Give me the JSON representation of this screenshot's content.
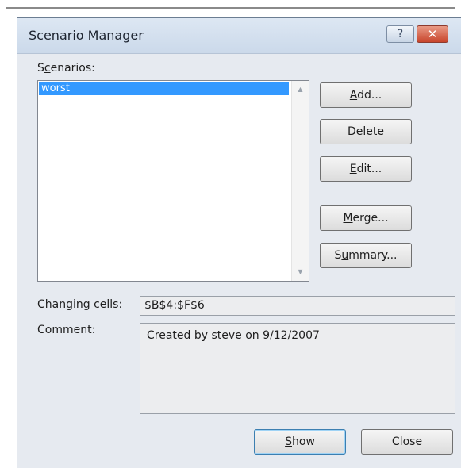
{
  "dialog": {
    "title": "Scenario Manager",
    "help_label": "?",
    "close_x_label": "✕"
  },
  "scenarios": {
    "label_pre": "S",
    "label_accel": "c",
    "label_post": "enarios:",
    "items": [
      "worst"
    ],
    "selected_index": 0
  },
  "buttons": {
    "add": {
      "accel": "A",
      "rest": "dd..."
    },
    "delete": {
      "accel": "D",
      "rest": "elete"
    },
    "edit": {
      "accel": "E",
      "rest": "dit..."
    },
    "merge": {
      "accel": "M",
      "rest": "erge..."
    },
    "summary": {
      "pre": "S",
      "accel": "u",
      "rest": "mmary..."
    },
    "show": {
      "accel": "S",
      "rest": "how"
    },
    "close": "Close"
  },
  "changing_cells": {
    "label": "Changing cells:",
    "value": "$B$4:$F$6"
  },
  "comment": {
    "label": "Comment:",
    "value": "Created by steve on 9/12/2007"
  },
  "icons": {
    "scroll_up": "▲",
    "scroll_down": "▼"
  }
}
